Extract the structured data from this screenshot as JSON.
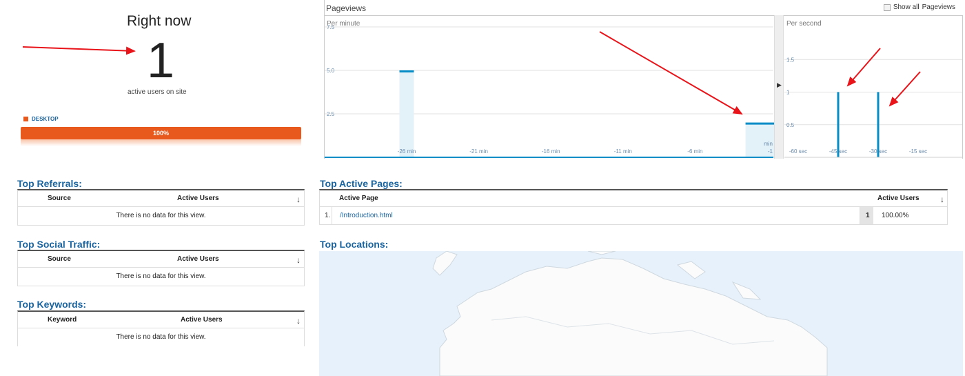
{
  "right_now": {
    "title": "Right now",
    "active_count": "1",
    "subtitle": "active users on site",
    "device_label": "DESKTOP",
    "device_percent": "100%",
    "device_fraction": 1.0,
    "device_color": "#e8591d"
  },
  "pageviews": {
    "title": "Pageviews",
    "show_all_label": "Show all",
    "show_all_suffix": "Pageviews",
    "show_all_checked": false,
    "collapse_icon": "chevron-right-icon",
    "per_minute_label": "Per minute",
    "per_second_label": "Per second"
  },
  "chart_data": [
    {
      "type": "bar",
      "title": "Per minute",
      "ylim": [
        0,
        7.5
      ],
      "y_ticks": [
        "2.5",
        "5.0",
        "7.5"
      ],
      "x_ticks": [
        "-26 min",
        "-21 min",
        "-16 min",
        "-11 min",
        "-6 min",
        "-1 min"
      ],
      "x": [
        -26,
        -2,
        -1
      ],
      "values": [
        5,
        2,
        2
      ],
      "color": "#058dc7"
    },
    {
      "type": "bar",
      "title": "Per second",
      "ylim": [
        0,
        2
      ],
      "y_ticks": [
        "0.5",
        "1",
        "1.5"
      ],
      "x_ticks": [
        "-60 sec",
        "-45 sec",
        "-30 sec",
        "-15 sec"
      ],
      "x": [
        -45,
        -30
      ],
      "values": [
        1,
        1
      ],
      "color": "#058dc7"
    }
  ],
  "referrals": {
    "title": "Top Referrals:",
    "col_source": "Source",
    "col_users": "Active Users",
    "empty": "There is no data for this view."
  },
  "social": {
    "title": "Top Social Traffic:",
    "col_source": "Source",
    "col_users": "Active Users",
    "empty": "There is no data for this view."
  },
  "keywords": {
    "title": "Top Keywords:",
    "col_keyword": "Keyword",
    "col_users": "Active Users",
    "empty": "There is no data for this view."
  },
  "active_pages": {
    "title": "Top Active Pages:",
    "col_page": "Active Page",
    "col_users": "Active Users",
    "rows": [
      {
        "index": "1.",
        "page": "/Introduction.html",
        "users": "1",
        "percent": "100.00%"
      }
    ]
  },
  "locations": {
    "title": "Top Locations:"
  }
}
